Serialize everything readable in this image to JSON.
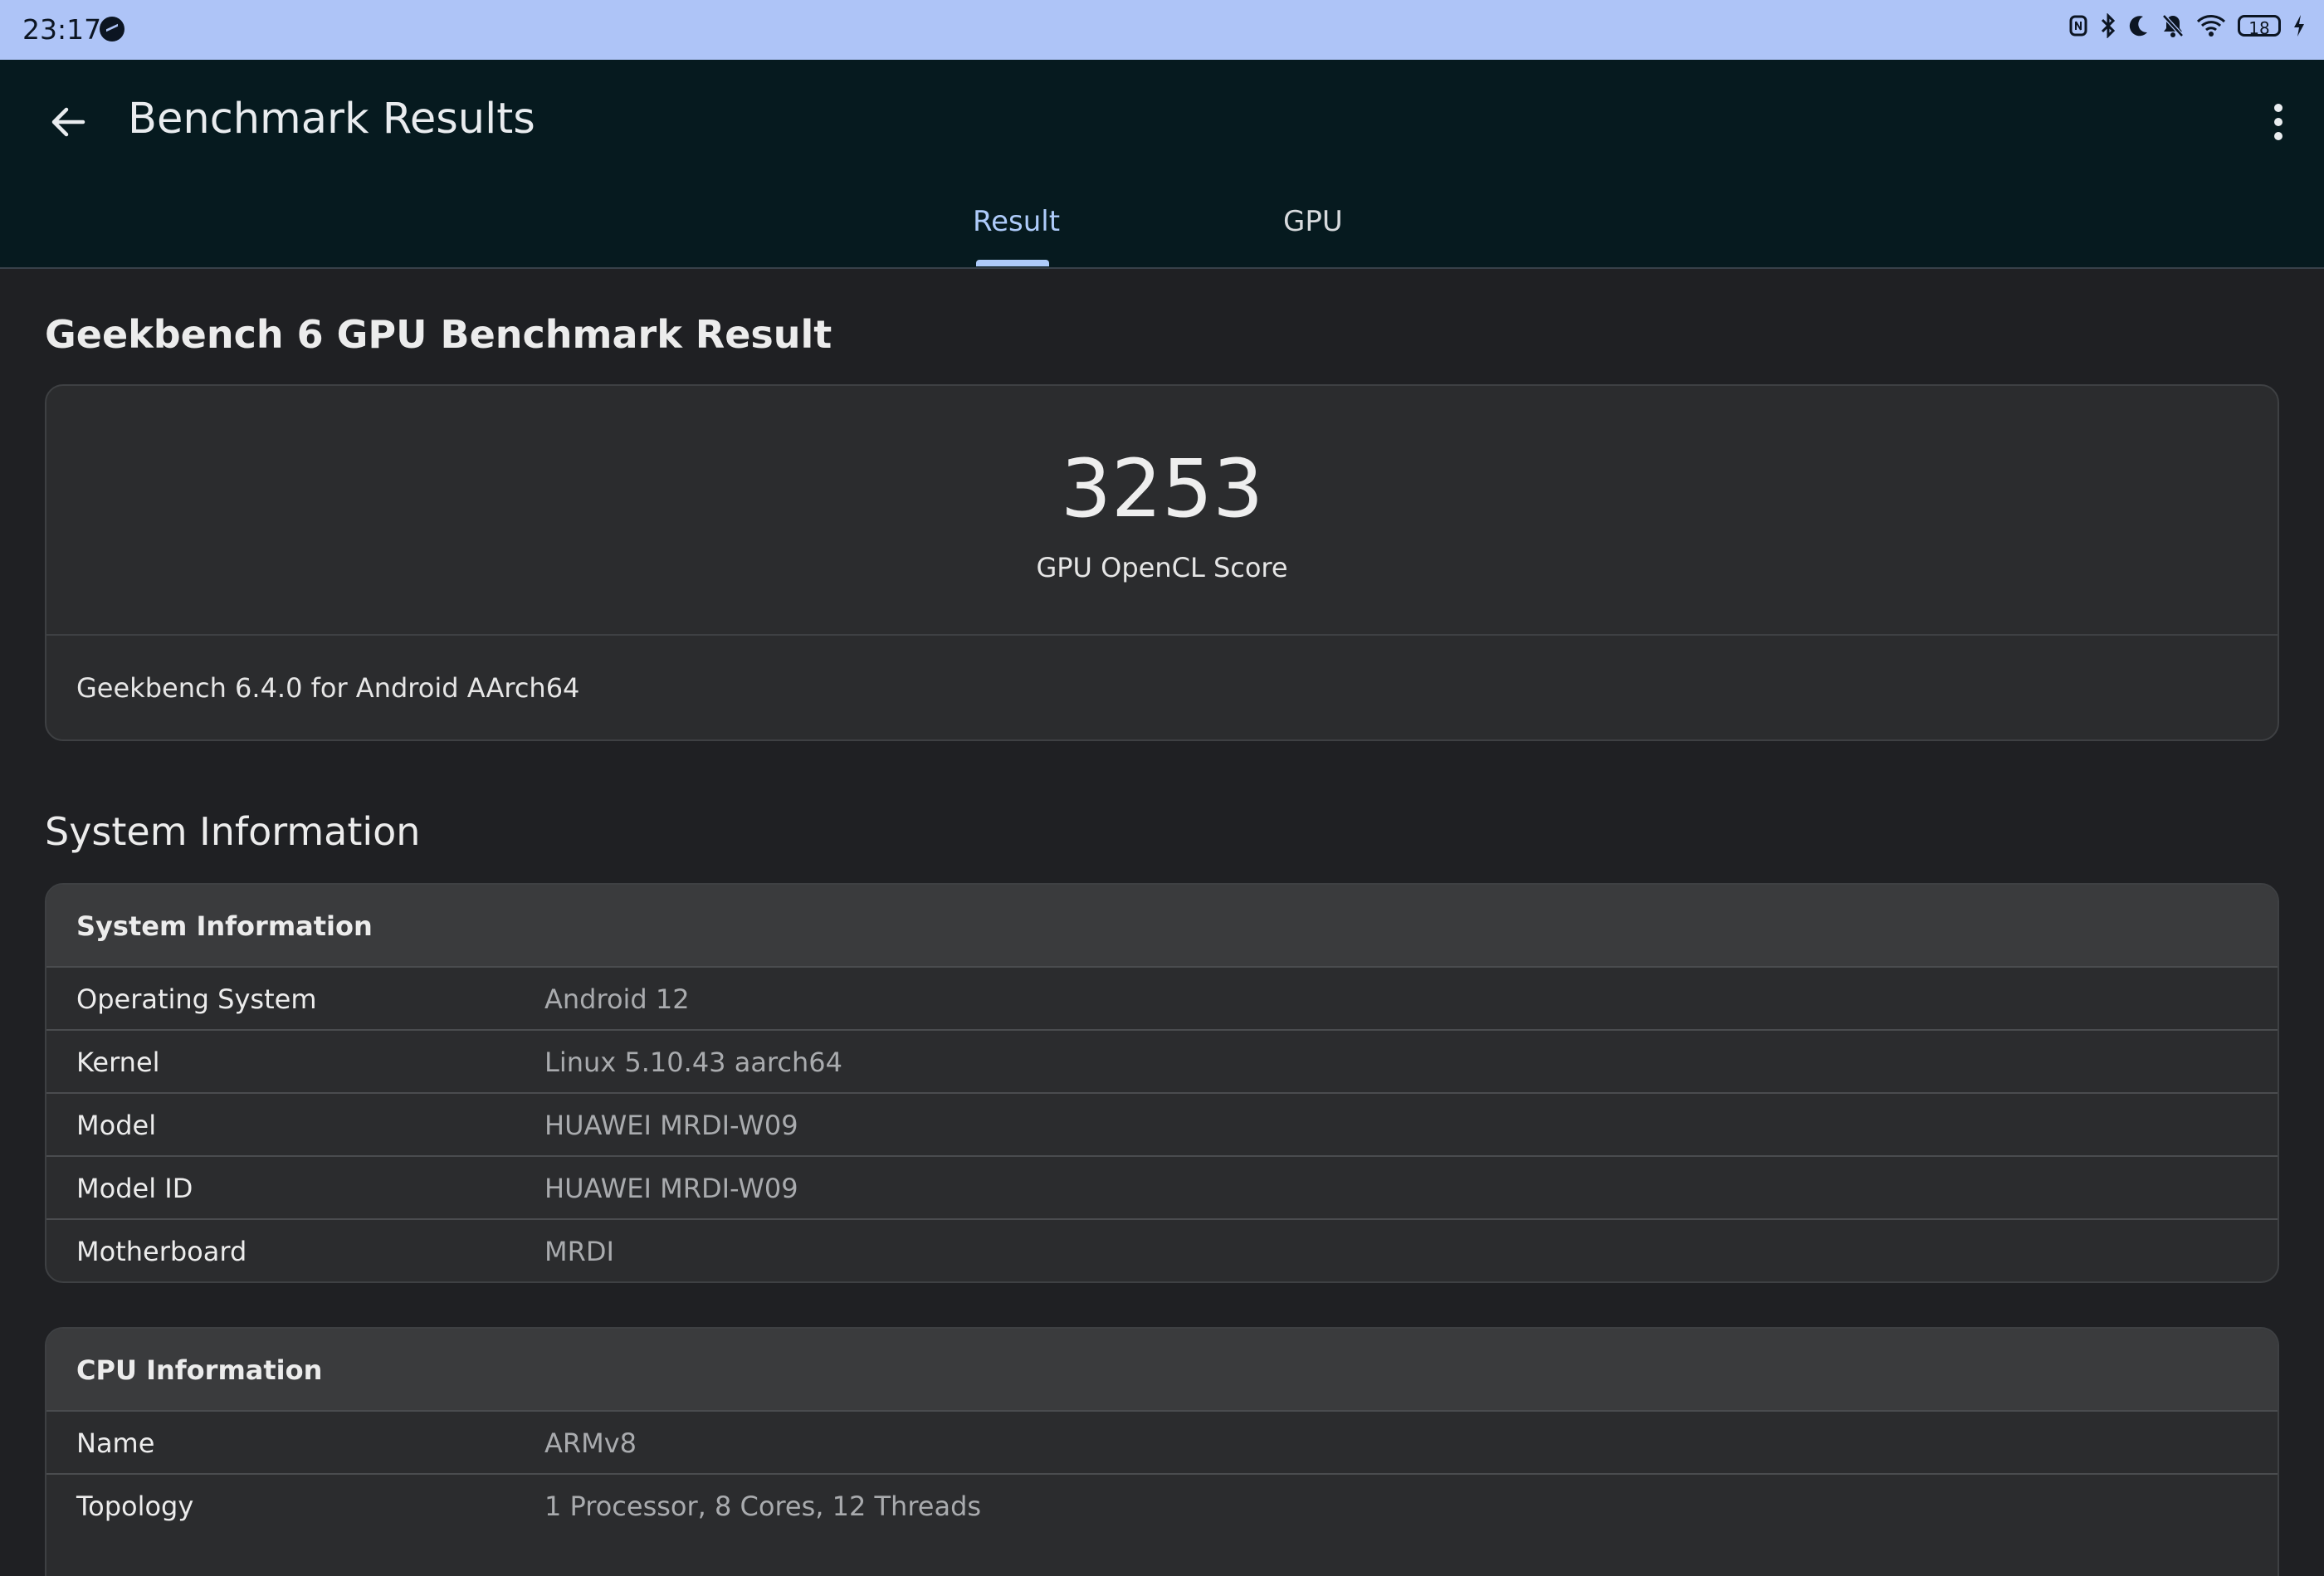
{
  "status_bar": {
    "time": "23:17",
    "battery": "18",
    "icons": [
      "nfc-icon",
      "bluetooth-icon",
      "moon-icon",
      "bell-off-icon",
      "wifi-icon",
      "battery-icon",
      "charging-icon"
    ]
  },
  "app_bar": {
    "title": "Benchmark Results",
    "tabs": [
      {
        "label": "Result",
        "selected": true
      },
      {
        "label": "GPU",
        "selected": false
      }
    ],
    "accent_color": "#aecbfa"
  },
  "result": {
    "heading": "Geekbench 6 GPU Benchmark Result",
    "score": "3253",
    "score_label": "GPU OpenCL Score",
    "version": "Geekbench 6.4.0 for Android AArch64"
  },
  "system_section": {
    "heading": "System Information",
    "table_title": "System Information",
    "rows": [
      {
        "key": "Operating System",
        "value": "Android 12"
      },
      {
        "key": "Kernel",
        "value": "Linux 5.10.43 aarch64"
      },
      {
        "key": "Model",
        "value": "HUAWEI MRDI-W09"
      },
      {
        "key": "Model ID",
        "value": "HUAWEI MRDI-W09"
      },
      {
        "key": "Motherboard",
        "value": "MRDI"
      }
    ]
  },
  "cpu_section": {
    "table_title": "CPU Information",
    "rows": [
      {
        "key": "Name",
        "value": "ARMv8"
      },
      {
        "key": "Topology",
        "value": "1 Processor, 8 Cores, 12 Threads"
      }
    ]
  }
}
